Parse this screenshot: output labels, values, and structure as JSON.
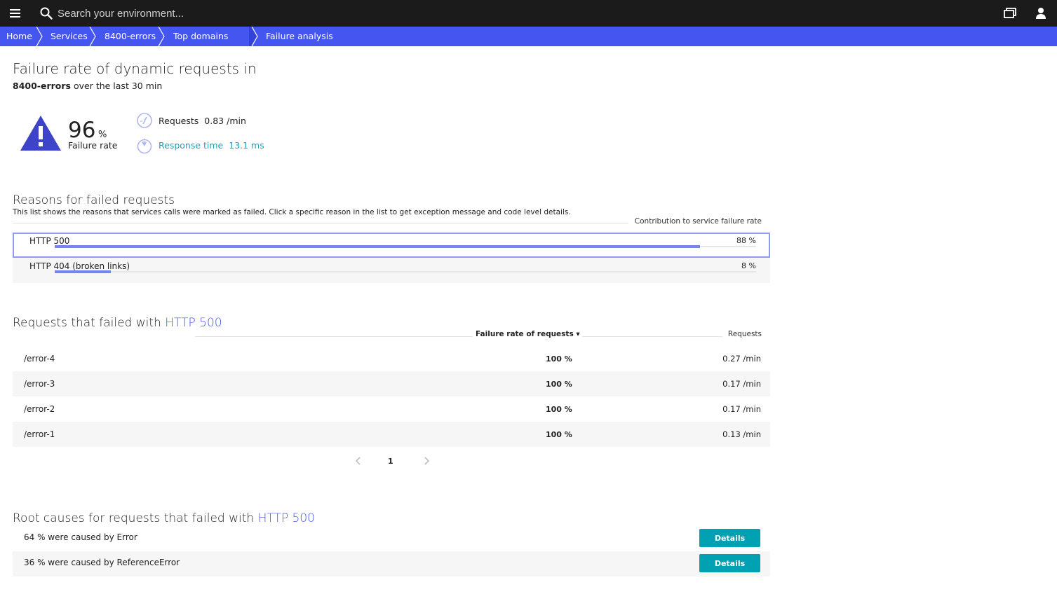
{
  "topbar": {
    "search_placeholder": "Search your environment..."
  },
  "icons": {
    "menu": "hamburger-menu-icon",
    "search": "search-icon",
    "windows": "windows-icon",
    "user": "user-icon"
  },
  "breadcrumb": [
    "Home",
    "Services",
    "8400-errors",
    "Top domains",
    "Failure analysis"
  ],
  "header": {
    "title": "Failure rate of dynamic requests in",
    "service": "8400-errors",
    "timeframe": "over the last 30 min"
  },
  "summary": {
    "failure_rate_value": "96",
    "failure_rate_unit": "%",
    "failure_rate_label": "Failure rate",
    "requests_label": "Requests",
    "requests_value": "0.83 /min",
    "response_time_label": "Response time",
    "response_time_value": "13.1 ms"
  },
  "reasons": {
    "title": "Reasons for failed requests",
    "description": "This list shows the reasons that services calls were marked as failed. Click a specific reason in the list to get exception message and code level details.",
    "column_header": "Contribution to service failure rate",
    "items": [
      {
        "name": "HTTP 500",
        "percent": "88 %",
        "fraction": 0.92
      },
      {
        "name": "HTTP 404 (broken links)",
        "percent": "8 %",
        "fraction": 0.08
      }
    ]
  },
  "failed_requests": {
    "title_prefix": "Requests that failed with",
    "title_link": "HTTP 500",
    "col_failure_rate": "Failure rate of requests ▾",
    "col_requests": "Requests",
    "rows": [
      {
        "path": "/error-4",
        "failure_rate": "100 %",
        "requests": "0.27 /min"
      },
      {
        "path": "/error-3",
        "failure_rate": "100 %",
        "requests": "0.17 /min"
      },
      {
        "path": "/error-2",
        "failure_rate": "100 %",
        "requests": "0.17 /min"
      },
      {
        "path": "/error-1",
        "failure_rate": "100 %",
        "requests": "0.13 /min"
      }
    ],
    "page": "1"
  },
  "root_causes": {
    "title_prefix": "Root causes for requests that failed with",
    "title_link": "HTTP 500",
    "items": [
      {
        "text": "64 % were caused by Error",
        "button": "Details"
      },
      {
        "text": "36 % were caused by ReferenceError",
        "button": "Details"
      }
    ]
  },
  "colors": {
    "topbar": "#1b1b1b",
    "breadcrumb": "#4556f0",
    "accent": "#4556f0",
    "teal": "#1da3b6",
    "button": "#00a1b2",
    "warning": "#3d44c8"
  }
}
